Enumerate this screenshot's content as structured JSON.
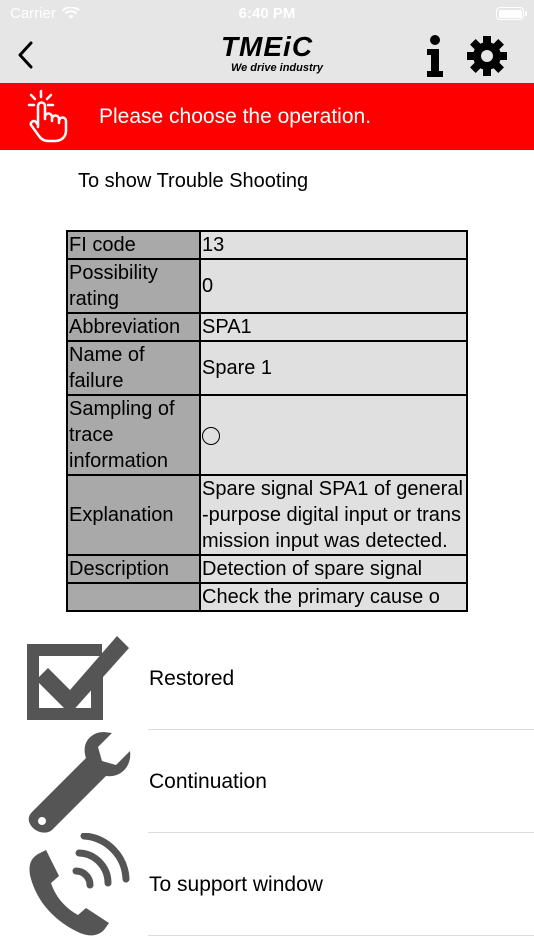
{
  "status_bar": {
    "carrier": "Carrier",
    "time": "6:40 PM",
    "battery_level": 1.0
  },
  "nav": {
    "back_icon": "chevron-left-icon",
    "logo_text": "TMEiC",
    "logo_tagline": "We drive industry",
    "info_icon": "info-icon",
    "settings_icon": "gear-icon"
  },
  "banner": {
    "icon": "tap-hand-icon",
    "text": "Please choose the operation.",
    "color": "#ff0000"
  },
  "subtitle": "To show Trouble Shooting",
  "table": {
    "rows": [
      {
        "key": "FI code",
        "value": "13"
      },
      {
        "key": "Possibility rating",
        "value": "0"
      },
      {
        "key": "Abbreviation",
        "value": "SPA1"
      },
      {
        "key": "Name of failure",
        "value": "Spare 1"
      },
      {
        "key": "Sampling of trace information",
        "value": "○"
      },
      {
        "key": "Explanation",
        "value": "Spare signal SPA1 of general-purpose digital input or transmission input was detected."
      },
      {
        "key": "Description",
        "value": "Detection of spare signal"
      },
      {
        "key": "",
        "value": "Check the primary cause o"
      }
    ]
  },
  "actions": [
    {
      "label": "Restored",
      "icon": "checkbox-checked-icon"
    },
    {
      "label": "Continuation",
      "icon": "wrench-icon"
    },
    {
      "label": "To support window",
      "icon": "phone-call-icon"
    }
  ]
}
